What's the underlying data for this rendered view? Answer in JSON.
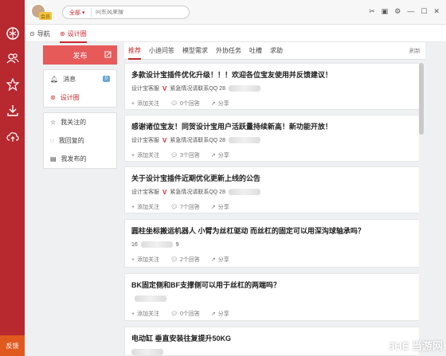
{
  "sidebar": {
    "icons": [
      "logo-icon",
      "users-icon",
      "star-icon",
      "download-icon",
      "cloud-upload-icon"
    ],
    "feedback_label": "反馈"
  },
  "topbar": {
    "vip_label": "会员",
    "scope_label": "全部",
    "search_placeholder": "问东风来搜"
  },
  "subheader": {
    "nav_label": "导航",
    "design_label": "设计圈"
  },
  "left_panel": {
    "publish_label": "发布",
    "items_top": [
      {
        "label": "消息",
        "badge": "0"
      },
      {
        "label": "设计圈"
      }
    ],
    "items_bottom": [
      {
        "label": "我关注的"
      },
      {
        "label": "我回复的"
      },
      {
        "label": "我发布的"
      }
    ]
  },
  "feed": {
    "tabs": [
      "推荐",
      "小迪问答",
      "模型需求",
      "外协任务",
      "吐槽",
      "求助"
    ],
    "refresh_label": "刷新",
    "follow_label": "添加关注",
    "share_label": "分享",
    "cards": [
      {
        "title": "多款设计宝插件优化升级！！！欢迎各位宝友使用并反馈建议！",
        "author": "设计宝客服",
        "contact": "紧急情况请联系QQ 28",
        "answers": "0个回答"
      },
      {
        "title": "感谢诸位宝友！同贺设计宝用户活跃量持续新高！新功能开放！",
        "author": "设计宝客服",
        "contact": "紧急情况请联系QQ 28",
        "answers": "3个回答"
      },
      {
        "title": "关于设计宝插件近期优化更新上线的公告",
        "author": "设计宝客服",
        "contact": "紧急情况请联系QQ 28",
        "answers": "7个回答"
      },
      {
        "title": "圆柱坐标搬运机器人 小臂为丝杠驱动 而丝杠的固定可以用深沟球轴承吗？",
        "author": "16",
        "contact": "9",
        "answers": "2个回答"
      },
      {
        "title": "BK固定侧和BF支撑侧可以用于丝杠的两端吗？",
        "author": "",
        "contact": "",
        "answers": "0个回答"
      },
      {
        "title": "电动缸 垂直安装往复提升50KG",
        "author": "",
        "contact": "",
        "answers": ""
      }
    ]
  },
  "watermark": "3HE 当游网"
}
